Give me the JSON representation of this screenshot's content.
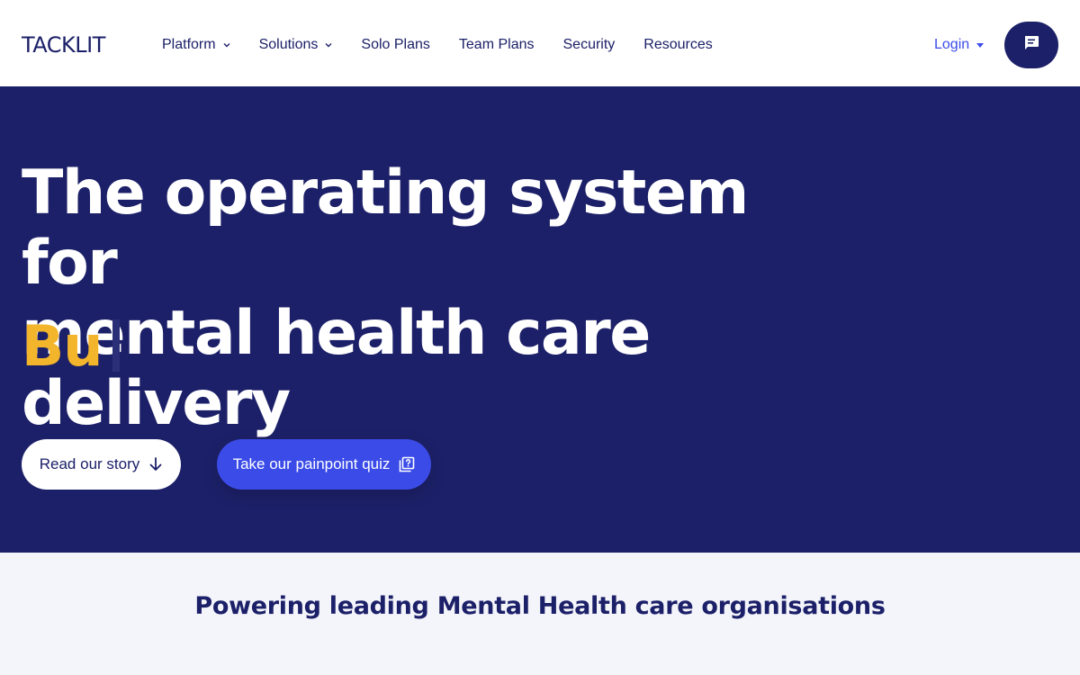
{
  "brand": {
    "logo_text": "TACKLIT"
  },
  "nav": {
    "items": [
      {
        "label": "Platform",
        "has_dropdown": true
      },
      {
        "label": "Solutions",
        "has_dropdown": true
      },
      {
        "label": "Solo Plans",
        "has_dropdown": false
      },
      {
        "label": "Team Plans",
        "has_dropdown": false
      },
      {
        "label": "Security",
        "has_dropdown": false
      },
      {
        "label": "Resources",
        "has_dropdown": false
      }
    ],
    "login_label": "Login",
    "chat_icon": "chat-message-icon"
  },
  "hero": {
    "headline_line1": "The operating system for",
    "headline_line2": "mental health care delivery",
    "typed_text": "Bu",
    "primary_button": {
      "label": "Read our story",
      "icon": "arrow-down-icon"
    },
    "secondary_button": {
      "label": "Take our painpoint quiz",
      "icon": "quiz-icon"
    }
  },
  "trusted": {
    "title": "Powering leading Mental Health care organisations"
  },
  "colors": {
    "navy": "#1c2068",
    "accent_blue": "#3b4be8",
    "highlight_yellow": "#f3b52c",
    "section_bg": "#f4f5fb"
  }
}
